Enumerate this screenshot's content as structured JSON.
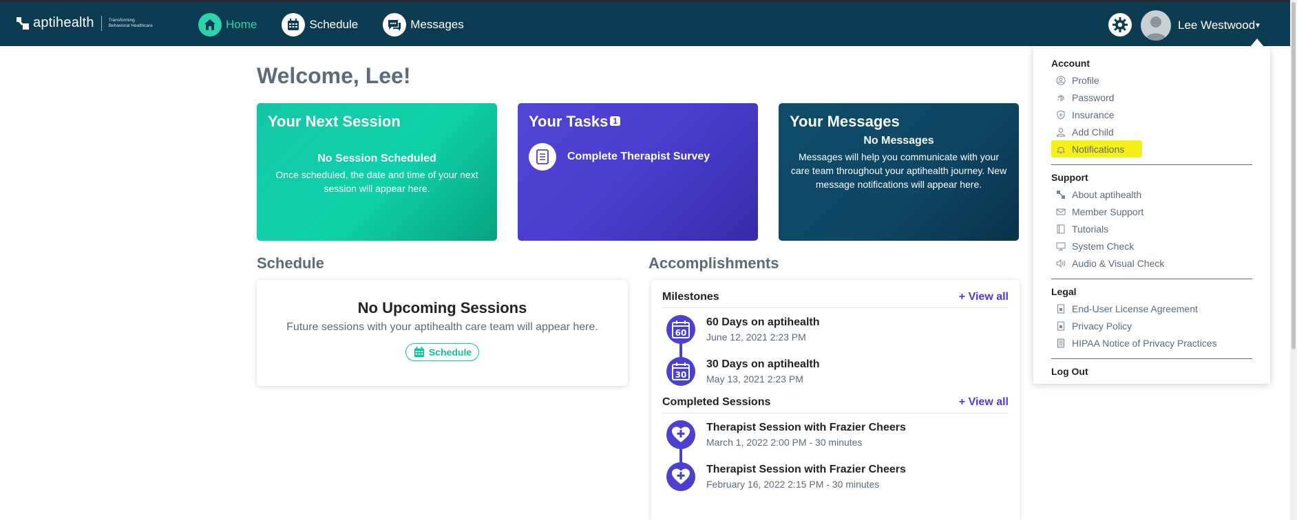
{
  "brand": {
    "name": "aptihealth",
    "tagline_line1": "Transforming",
    "tagline_line2": "Behavioral Healthcare"
  },
  "nav": {
    "items": [
      {
        "label": "Home",
        "icon": "home-icon",
        "active": true
      },
      {
        "label": "Schedule",
        "icon": "calendar-icon",
        "active": false
      },
      {
        "label": "Messages",
        "icon": "chat-icon",
        "active": false
      }
    ]
  },
  "user": {
    "name": "Lee Westwood"
  },
  "welcome": "Welcome, Lee!",
  "cards": {
    "next_session": {
      "title": "Your Next Session",
      "status": "No Session Scheduled",
      "description": "Once scheduled, the date and time of your next session will appear here."
    },
    "tasks": {
      "title": "Your Tasks",
      "badge": "1",
      "task": "Complete Therapist Survey"
    },
    "messages": {
      "title": "Your Messages",
      "status": "No Messages",
      "description": "Messages will help you communicate with your care team throughout your aptihealth journey. New message notifications will appear here."
    }
  },
  "schedule": {
    "section_title": "Schedule",
    "empty_title": "No Upcoming Sessions",
    "empty_sub": "Future sessions with your aptihealth care team will appear here.",
    "button": "Schedule"
  },
  "accomplishments": {
    "section_title": "Accomplishments",
    "milestones": {
      "title": "Milestones",
      "view_all": "+ View all",
      "items": [
        {
          "badge": "60",
          "title": "60 Days on aptihealth",
          "date": "June 12, 2021 2:23 PM"
        },
        {
          "badge": "30",
          "title": "30 Days on aptihealth",
          "date": "May 13, 2021 2:23 PM"
        }
      ]
    },
    "completed": {
      "title": "Completed Sessions",
      "view_all": "+ View all",
      "items": [
        {
          "title": "Therapist Session with Frazier Cheers",
          "date": "March 1, 2022 2:00 PM - 30 minutes"
        },
        {
          "title": "Therapist Session with Frazier Cheers",
          "date": "February 16, 2022 2:15 PM - 30 minutes"
        }
      ]
    }
  },
  "dropdown": {
    "account": {
      "heading": "Account",
      "items": [
        {
          "label": "Profile",
          "icon": "user-circle-icon"
        },
        {
          "label": "Password",
          "icon": "fingerprint-icon"
        },
        {
          "label": "Insurance",
          "icon": "shield-plus-icon"
        },
        {
          "label": "Add Child",
          "icon": "person-icon"
        },
        {
          "label": "Notifications",
          "icon": "bell-icon"
        }
      ]
    },
    "support": {
      "heading": "Support",
      "items": [
        {
          "label": "About aptihealth",
          "icon": "aptihealth-logo-icon"
        },
        {
          "label": "Member Support",
          "icon": "envelope-icon"
        },
        {
          "label": "Tutorials",
          "icon": "book-icon"
        },
        {
          "label": "System Check",
          "icon": "monitor-icon"
        },
        {
          "label": "Audio & Visual Check",
          "icon": "speaker-icon"
        }
      ]
    },
    "legal": {
      "heading": "Legal",
      "items": [
        {
          "label": "End-User License Agreement",
          "icon": "document-lock-icon"
        },
        {
          "label": "Privacy Policy",
          "icon": "document-lock-icon"
        },
        {
          "label": "HIPAA Notice of Privacy Practices",
          "icon": "document-icon"
        }
      ]
    },
    "logout": "Log Out"
  },
  "colors": {
    "topbar": "#0d3b51",
    "accent_teal": "#2bd3ac",
    "accent_purple": "#4a3dcf",
    "highlight": "#f5f018"
  }
}
